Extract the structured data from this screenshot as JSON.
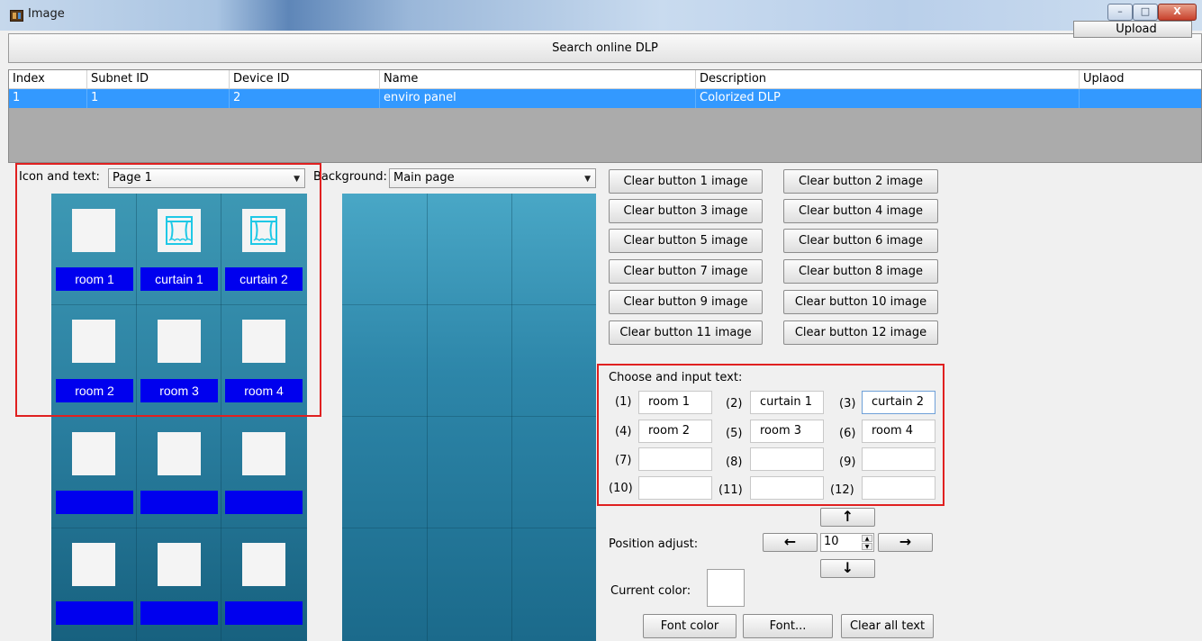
{
  "window": {
    "title": "Image",
    "min": "–",
    "max": "□",
    "close": "X"
  },
  "search_button": "Search online DLP",
  "table": {
    "headers": [
      "Index",
      "Subnet ID",
      "Device ID",
      "Name",
      "Description",
      "Uplaod"
    ],
    "rows": [
      {
        "index": "1",
        "subnet_id": "1",
        "device_id": "2",
        "name": "enviro panel",
        "description": "Colorized DLP",
        "action": "Upload"
      }
    ]
  },
  "icon_and_text": {
    "label": "Icon and text:",
    "selected": "Page 1"
  },
  "background": {
    "label": "Background:",
    "selected": "Main page"
  },
  "preview_labels": [
    "room 1",
    "curtain 1",
    "curtain 2",
    "room 2",
    "room 3",
    "room 4",
    "",
    "",
    "",
    "",
    "",
    ""
  ],
  "clear_buttons": [
    "Clear button 1 image",
    "Clear button 2 image",
    "Clear button 3 image",
    "Clear button 4 image",
    "Clear button 5 image",
    "Clear button 6 image",
    "Clear button 7 image",
    "Clear button 8 image",
    "Clear button 9 image",
    "Clear button 10 image",
    "Clear button 11 image",
    "Clear button 12 image"
  ],
  "choose_text": {
    "title": "Choose and input text:",
    "numbers": [
      "(1)",
      "(2)",
      "(3)",
      "(4)",
      "(5)",
      "(6)",
      "(7)",
      "(8)",
      "(9)",
      "(10)",
      "(11)",
      "(12)"
    ],
    "values": [
      "room 1",
      "curtain 1",
      "curtain 2",
      "room 2",
      "room 3",
      "room 4",
      "",
      "",
      "",
      "",
      "",
      ""
    ]
  },
  "position_adjust": {
    "label": "Position adjust:",
    "value": "10",
    "up": "↑",
    "down": "↓",
    "left": "←",
    "right": "→"
  },
  "current_color": {
    "label": "Current color:",
    "color": "#ffffff"
  },
  "footer_buttons": {
    "font_color": "Font color",
    "font": "Font...",
    "clear_all": "Clear all text"
  },
  "colors": {
    "selection": "#3399ff",
    "label_bg": "#0000ee",
    "highlight_box": "#e02020"
  }
}
